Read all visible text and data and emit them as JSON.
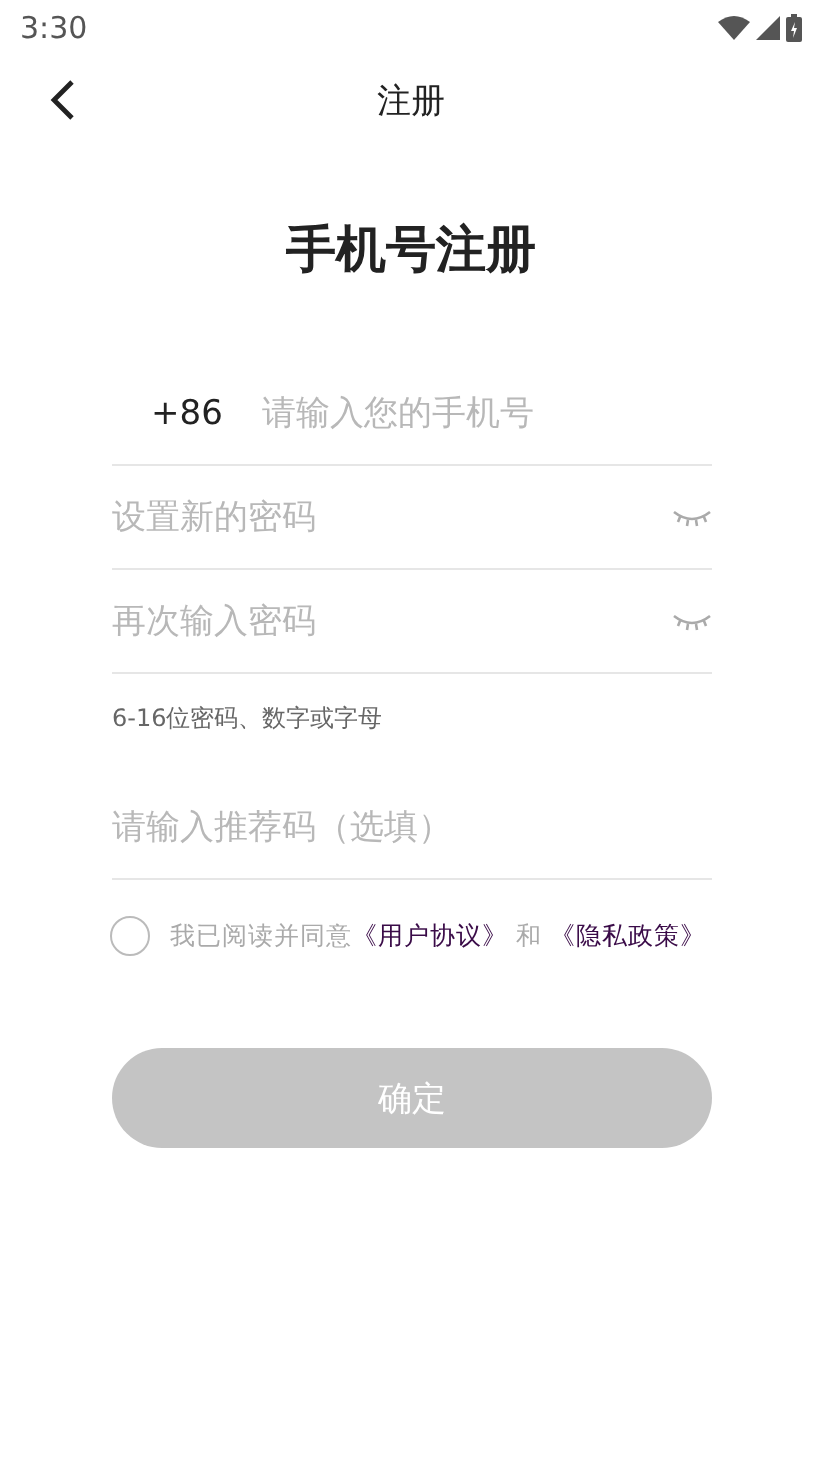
{
  "status_bar": {
    "time": "3:30"
  },
  "header": {
    "title": "注册"
  },
  "heading": "手机号注册",
  "phone": {
    "country_code": "+86",
    "placeholder": "请输入您的手机号"
  },
  "password_fields": [
    {
      "placeholder": "设置新的密码",
      "visible": false
    },
    {
      "placeholder": "再次输入密码",
      "visible": false
    }
  ],
  "hint": "6-16位密码、数字或字母",
  "referral": {
    "placeholder": "请输入推荐码（选填）"
  },
  "agreement": {
    "checked": false,
    "text": "我已阅读并同意",
    "link_1": "《用户协议》",
    "joiner": "和",
    "link_2": "《隐私政策》"
  },
  "submit": {
    "label": "确定",
    "disabled": true
  }
}
